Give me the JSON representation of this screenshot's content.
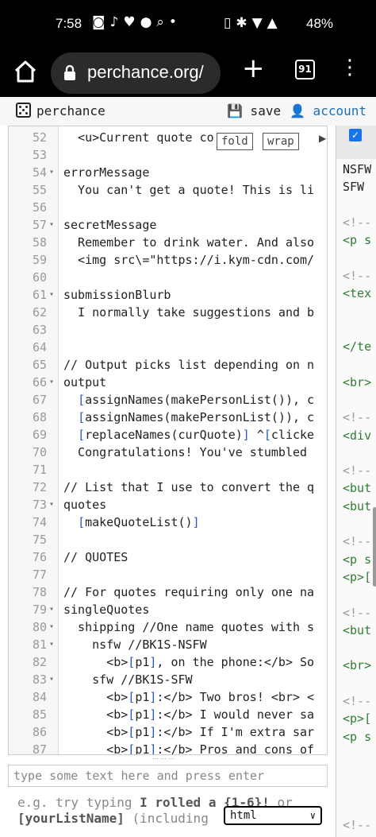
{
  "status": {
    "time": "7:58",
    "notif_glyphs": "◙♪♥●⌕•",
    "sys_glyphs": "▯✱▼▲",
    "battery": "48%"
  },
  "browser": {
    "url": "perchance.org/",
    "tab_count": "91"
  },
  "header": {
    "brand": "perchance",
    "save": "💾 save",
    "account": "👤 account"
  },
  "editor": {
    "fold_label": "fold",
    "wrap_label": "wrap",
    "lines": [
      {
        "n": "52",
        "f": "",
        "t": "  <u>Current quote co"
      },
      {
        "n": "53",
        "f": "",
        "t": ""
      },
      {
        "n": "54",
        "f": "▾",
        "t": "errorMessage"
      },
      {
        "n": "55",
        "f": "",
        "t": "  You can't get a quote! This is li"
      },
      {
        "n": "56",
        "f": "",
        "t": ""
      },
      {
        "n": "57",
        "f": "▾",
        "t": "secretMessage"
      },
      {
        "n": "58",
        "f": "",
        "t": "  Remember to drink water. And also"
      },
      {
        "n": "59",
        "f": "",
        "t": "  <img src\\=\"https://i.kym-cdn.com/"
      },
      {
        "n": "60",
        "f": "",
        "t": ""
      },
      {
        "n": "61",
        "f": "▾",
        "t": "submissionBlurb"
      },
      {
        "n": "62",
        "f": "",
        "t": "  I normally take suggestions and b"
      },
      {
        "n": "63",
        "f": "",
        "t": ""
      },
      {
        "n": "64",
        "f": "",
        "t": ""
      },
      {
        "n": "65",
        "f": "",
        "t": "// Output picks list depending on n"
      },
      {
        "n": "66",
        "f": "▾",
        "t": "output"
      },
      {
        "n": "67",
        "f": "",
        "t": "  [assignNames(makePersonList()), c"
      },
      {
        "n": "68",
        "f": "",
        "t": "  [assignNames(makePersonList()), c"
      },
      {
        "n": "69",
        "f": "",
        "t": "  [replaceNames(curQuote)] ^[clicke"
      },
      {
        "n": "70",
        "f": "",
        "t": "  Congratulations! You've stumbled "
      },
      {
        "n": "71",
        "f": "",
        "t": ""
      },
      {
        "n": "72",
        "f": "",
        "t": "// List that I use to convert the q"
      },
      {
        "n": "73",
        "f": "▾",
        "t": "quotes"
      },
      {
        "n": "74",
        "f": "",
        "t": "  [makeQuoteList()]"
      },
      {
        "n": "75",
        "f": "",
        "t": ""
      },
      {
        "n": "76",
        "f": "",
        "t": "// QUOTES"
      },
      {
        "n": "77",
        "f": "",
        "t": ""
      },
      {
        "n": "78",
        "f": "",
        "t": "// For quotes requiring only one na"
      },
      {
        "n": "79",
        "f": "▾",
        "t": "singleQuotes"
      },
      {
        "n": "80",
        "f": "▾",
        "t": "  shipping //One name quotes with s"
      },
      {
        "n": "81",
        "f": "▾",
        "t": "    nsfw //BK1S-NSFW"
      },
      {
        "n": "82",
        "f": "",
        "t": "      <b>[p1], on the phone:</b> So"
      },
      {
        "n": "83",
        "f": "▾",
        "t": "    sfw //BK1S-SFW"
      },
      {
        "n": "84",
        "f": "",
        "t": "      <b>[p1]:</b> Two bros! <br> <"
      },
      {
        "n": "85",
        "f": "",
        "t": "      <b>[p1]:</b> I would never sa"
      },
      {
        "n": "86",
        "f": "",
        "t": "      <b>[p1]:</b> If I'm extra sar"
      },
      {
        "n": "87",
        "f": "",
        "t": "      <b>[p1]:</b> Pros and cons of"
      }
    ]
  },
  "right_panel": {
    "lines": [
      {
        "t": "NSFW",
        "c": "dark"
      },
      {
        "t": "SFW",
        "c": "dark"
      },
      {
        "t": "",
        "c": ""
      },
      {
        "t": "<!--",
        "c": "gray"
      },
      {
        "t": "<p s",
        "c": ""
      },
      {
        "t": "",
        "c": ""
      },
      {
        "t": "<!--",
        "c": "gray"
      },
      {
        "t": "<tex",
        "c": ""
      },
      {
        "t": "",
        "c": ""
      },
      {
        "t": "",
        "c": ""
      },
      {
        "t": "</te",
        "c": ""
      },
      {
        "t": "",
        "c": ""
      },
      {
        "t": "<br>",
        "c": ""
      },
      {
        "t": "",
        "c": ""
      },
      {
        "t": "<!--",
        "c": "gray"
      },
      {
        "t": "<div",
        "c": ""
      },
      {
        "t": "",
        "c": ""
      },
      {
        "t": "<!--",
        "c": "gray"
      },
      {
        "t": "<but",
        "c": ""
      },
      {
        "t": "<but",
        "c": ""
      },
      {
        "t": "",
        "c": ""
      },
      {
        "t": "<!--",
        "c": "gray"
      },
      {
        "t": "<p s",
        "c": ""
      },
      {
        "t": "<p>[",
        "c": ""
      },
      {
        "t": "",
        "c": ""
      },
      {
        "t": "<!--",
        "c": "gray"
      },
      {
        "t": "<but",
        "c": ""
      },
      {
        "t": "",
        "c": ""
      },
      {
        "t": "<br>",
        "c": ""
      },
      {
        "t": "",
        "c": ""
      },
      {
        "t": "<!--",
        "c": "gray"
      },
      {
        "t": "<p>[",
        "c": ""
      },
      {
        "t": "<p s",
        "c": ""
      },
      {
        "t": "",
        "c": ""
      },
      {
        "t": "",
        "c": ""
      },
      {
        "t": "",
        "c": ""
      },
      {
        "t": "",
        "c": ""
      },
      {
        "t": "<!--",
        "c": "gray"
      }
    ]
  },
  "bottom": {
    "input_placeholder": "type some text here and press enter",
    "hint_prefix": "e.g. try typing ",
    "hint_bold": "I rolled a {1-6}!",
    "hint_suffix": " or",
    "hint2_bold": "[yourListName]",
    "hint2_suffix": " (including",
    "select_value": "html"
  }
}
